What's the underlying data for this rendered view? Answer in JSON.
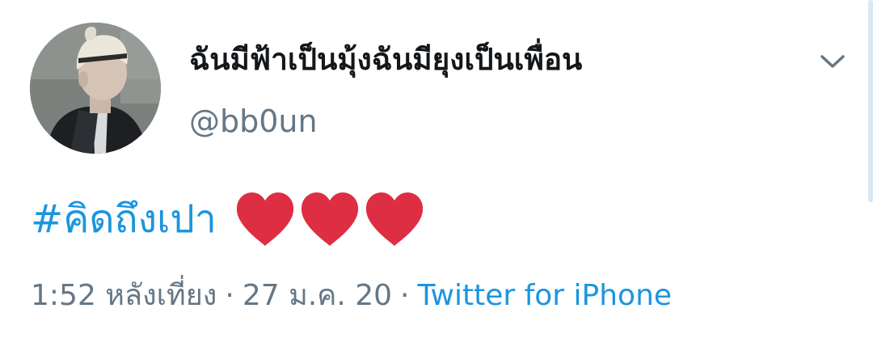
{
  "tweet": {
    "author": {
      "display_name": "ฉันมีฟ้าเป็นมุ้งฉันมียุงเป็นเพื่อน",
      "handle": "@bb0un",
      "avatar_icon": "profile-photo"
    },
    "menu_icon": "chevron-down-icon",
    "text": {
      "hashtag": "#คิดถึงเปา",
      "emoji": [
        "❤",
        "❤",
        "❤"
      ]
    },
    "meta": {
      "time": "1:52 หลังเที่ยง",
      "separator": "·",
      "date": "27 ม.ค. 20",
      "source": "Twitter for iPhone"
    }
  },
  "colors": {
    "text": "#14171a",
    "muted": "#657786",
    "link": "#1b95e0",
    "heart": "#dd2e44"
  }
}
